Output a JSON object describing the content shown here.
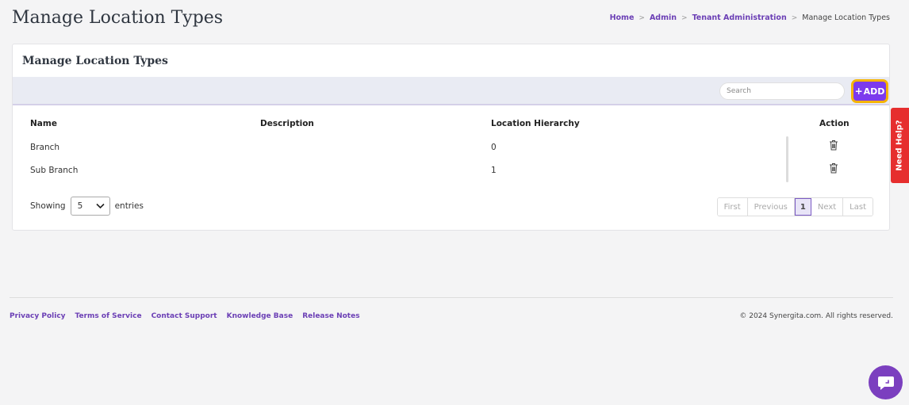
{
  "page": {
    "title": "Manage Location Types"
  },
  "breadcrumb": {
    "items": [
      "Home",
      "Admin",
      "Tenant Administration"
    ],
    "current": "Manage Location Types"
  },
  "card": {
    "title": "Manage Location Types"
  },
  "toolbar": {
    "search_placeholder": "Search",
    "add_label": "ADD"
  },
  "table": {
    "headers": {
      "name": "Name",
      "description": "Description",
      "hierarchy": "Location Hierarchy",
      "action": "Action"
    },
    "rows": [
      {
        "name": "Branch",
        "description": "",
        "hierarchy": "0"
      },
      {
        "name": "Sub Branch",
        "description": "",
        "hierarchy": "1"
      }
    ]
  },
  "length": {
    "prefix": "Showing",
    "value": "5",
    "suffix": "entries"
  },
  "pagination": {
    "first": "First",
    "previous": "Previous",
    "current": "1",
    "next": "Next",
    "last": "Last"
  },
  "help": {
    "label": "Need Help?"
  },
  "footer": {
    "links": [
      "Privacy Policy",
      "Terms of Service",
      "Contact Support",
      "Knowledge Base",
      "Release Notes"
    ],
    "copyright": "© 2024 Synergita.com. All rights reserved."
  },
  "colors": {
    "accent": "#7c3aed",
    "highlight": "#f5b400",
    "help": "#e62e2e",
    "link": "#6b3fb5"
  },
  "icons": {
    "delete": "trash-icon",
    "chat": "chat-icon",
    "dropdown": "chevron-down-icon"
  }
}
